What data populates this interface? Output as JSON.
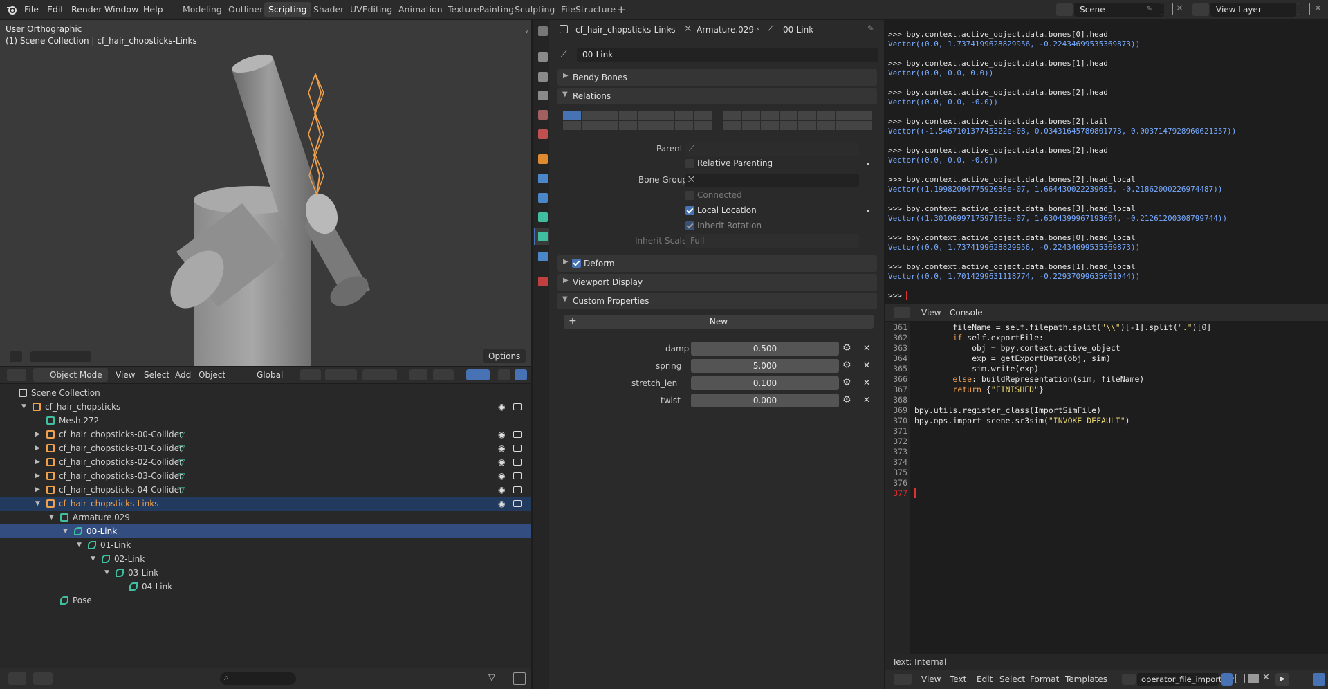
{
  "topbar": {
    "menus": [
      "File",
      "Edit",
      "Render",
      "Window",
      "Help"
    ],
    "workspaces": [
      "Modeling",
      "Outliner",
      "Scripting",
      "Shader",
      "UVEditing",
      "Animation",
      "TexturePainting",
      "Sculpting",
      "FileStructure"
    ],
    "active_workspace": "Scripting",
    "add_tab": "+",
    "scene_label": "Scene",
    "view_layer_label": "View Layer"
  },
  "viewport": {
    "title": "User Orthographic",
    "subtitle": "(1) Scene Collection | cf_hair_chopsticks-Links",
    "options_label": "Options",
    "header": {
      "mode": "Object Mode",
      "menus": [
        "View",
        "Select",
        "Add",
        "Object"
      ],
      "orientation": "Global"
    }
  },
  "outliner": {
    "rows": [
      {
        "label": "Scene Collection",
        "depth": 0,
        "icon": "collection-icon",
        "toggle": "",
        "color": "#d0d0d0",
        "vis": false
      },
      {
        "label": "cf_hair_chopsticks",
        "depth": 1,
        "icon": "mesh-object-icon",
        "toggle": "▼",
        "color": "#d0d0d0",
        "vis": true
      },
      {
        "label": "Mesh.272",
        "depth": 2,
        "icon": "mesh-data-icon",
        "toggle": "",
        "color": "#d0d0d0",
        "vis": false
      },
      {
        "label": "cf_hair_chopsticks-00-Collider",
        "depth": 2,
        "icon": "mesh-object-icon",
        "toggle": "▶",
        "color": "#d0d0d0",
        "vis": true,
        "extra": true
      },
      {
        "label": "cf_hair_chopsticks-01-Collider",
        "depth": 2,
        "icon": "mesh-object-icon",
        "toggle": "▶",
        "color": "#d0d0d0",
        "vis": true,
        "extra": true
      },
      {
        "label": "cf_hair_chopsticks-02-Collider",
        "depth": 2,
        "icon": "mesh-object-icon",
        "toggle": "▶",
        "color": "#d0d0d0",
        "vis": true,
        "extra": true
      },
      {
        "label": "cf_hair_chopsticks-03-Collider",
        "depth": 2,
        "icon": "mesh-object-icon",
        "toggle": "▶",
        "color": "#d0d0d0",
        "vis": true,
        "extra": true
      },
      {
        "label": "cf_hair_chopsticks-04-Collider",
        "depth": 2,
        "icon": "mesh-object-icon",
        "toggle": "▶",
        "color": "#d0d0d0",
        "vis": true,
        "extra": true
      },
      {
        "label": "cf_hair_chopsticks-Links",
        "depth": 2,
        "icon": "armature-object-icon",
        "toggle": "▼",
        "color": "#f0a04a",
        "vis": true,
        "selected": "parent"
      },
      {
        "label": "Armature.029",
        "depth": 3,
        "icon": "armature-data-icon",
        "toggle": "▼",
        "color": "#d0d0d0",
        "vis": false
      },
      {
        "label": "00-Link",
        "depth": 4,
        "icon": "bone-icon",
        "toggle": "▼",
        "color": "#ffffff",
        "vis": false,
        "selected": "active"
      },
      {
        "label": "01-Link",
        "depth": 5,
        "icon": "bone-icon",
        "toggle": "▼",
        "color": "#d0d0d0",
        "vis": false
      },
      {
        "label": "02-Link",
        "depth": 6,
        "icon": "bone-icon",
        "toggle": "▼",
        "color": "#d0d0d0",
        "vis": false
      },
      {
        "label": "03-Link",
        "depth": 7,
        "icon": "bone-icon",
        "toggle": "▼",
        "color": "#d0d0d0",
        "vis": false
      },
      {
        "label": "04-Link",
        "depth": 8,
        "icon": "bone-icon",
        "toggle": "",
        "color": "#d0d0d0",
        "vis": false
      },
      {
        "label": "Pose",
        "depth": 3,
        "icon": "pose-icon",
        "toggle": "",
        "color": "#d0d0d0",
        "vis": false
      }
    ]
  },
  "properties": {
    "breadcrumb": [
      "cf_hair_chopsticks-Links",
      "Armature.029",
      "00-Link"
    ],
    "bone_name": "00-Link",
    "panels": {
      "bendy": "Bendy Bones",
      "relations": "Relations",
      "deform": "Deform",
      "viewport_display": "Viewport Display",
      "custom_props": "Custom Properties"
    },
    "relations": {
      "parent_label": "Parent",
      "relative_parenting": "Relative Parenting",
      "bone_group_label": "Bone Group",
      "connected": "Connected",
      "local_location": "Local Location",
      "inherit_rotation": "Inherit Rotation",
      "inherit_scale_label": "Inherit Scale",
      "inherit_scale_value": "Full"
    },
    "new_button": "New",
    "custom": [
      {
        "name": "damp",
        "value": "0.500"
      },
      {
        "name": "spring",
        "value": "5.000"
      },
      {
        "name": "stretch_len",
        "value": "0.100"
      },
      {
        "name": "twist",
        "value": "0.000"
      }
    ]
  },
  "console": {
    "lines": [
      {
        "type": "cmd",
        "text": ">>> bpy.context.active_object.data.bones[0].head"
      },
      {
        "type": "out",
        "text": "Vector((0.0, 1.7374199628829956, -0.22434699535369873))"
      },
      {
        "type": "cmd",
        "text": ">>> bpy.context.active_object.data.bones[1].head"
      },
      {
        "type": "out",
        "text": "Vector((0.0, 0.0, 0.0))"
      },
      {
        "type": "cmd",
        "text": ">>> bpy.context.active_object.data.bones[2].head"
      },
      {
        "type": "out",
        "text": "Vector((0.0, 0.0, -0.0))"
      },
      {
        "type": "cmd",
        "text": ">>> bpy.context.active_object.data.bones[2].tail"
      },
      {
        "type": "out",
        "text": "Vector((-1.546710137745322e-08, 0.03431645780801773, 0.0037147928960621357))"
      },
      {
        "type": "cmd",
        "text": ">>> bpy.context.active_object.data.bones[2].head"
      },
      {
        "type": "out",
        "text": "Vector((0.0, 0.0, -0.0))"
      },
      {
        "type": "cmd",
        "text": ">>> bpy.context.active_object.data.bones[2].head_local"
      },
      {
        "type": "out",
        "text": "Vector((1.1998200477592036e-07, 1.664430022239685, -0.21862000226974487))"
      },
      {
        "type": "cmd",
        "text": ">>> bpy.context.active_object.data.bones[3].head_local"
      },
      {
        "type": "out",
        "text": "Vector((1.3010699717597163e-07, 1.6304399967193604, -0.21261200308799744))"
      },
      {
        "type": "cmd",
        "text": ">>> bpy.context.active_object.data.bones[0].head_local"
      },
      {
        "type": "out",
        "text": "Vector((0.0, 1.7374199628829956, -0.22434699535369873))"
      },
      {
        "type": "cmd",
        "text": ">>> bpy.context.active_object.data.bones[1].head_local"
      },
      {
        "type": "out",
        "text": "Vector((0.0, 1.7014299631118774, -0.22937099635601044))"
      }
    ],
    "prompt": ">>>",
    "header_menus": [
      "View",
      "Console"
    ]
  },
  "text_editor": {
    "line_numbers": [
      "361",
      "362",
      "363",
      "364",
      "365",
      "366",
      "367",
      "368",
      "369",
      "370",
      "371",
      "372",
      "373",
      "374",
      "375",
      "376",
      "377"
    ],
    "code": [
      "        fileName = self.filepath.split(\"\\\\\")[-1].split(\".\")[0]",
      "        if self.exportFile:",
      "            obj = bpy.context.active_object",
      "            exp = getExportData(obj, sim)",
      "            sim.write(exp)",
      "        else: buildRepresentation(sim, fileName)",
      "        return {\"FINISHED\"}",
      "",
      "bpy.utils.register_class(ImportSimFile)",
      "bpy.ops.import_scene.sr3sim(\"INVOKE_DEFAULT\")",
      "",
      "",
      "",
      "",
      "",
      "",
      ""
    ],
    "status": "Text: Internal",
    "menus": [
      "View",
      "Text",
      "Edit",
      "Select",
      "Format",
      "Templates"
    ],
    "filename": "operator_file_import.py"
  },
  "colors": {
    "accent": "#4772b3",
    "selected_row": "#334d80",
    "parent_row": "#223a5e",
    "armature_orange": "#f0a04a",
    "bone_green": "#3fbfa0"
  }
}
